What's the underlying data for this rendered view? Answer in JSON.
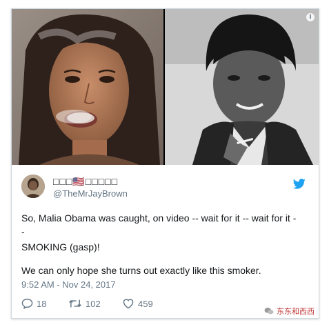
{
  "tweet": {
    "display_name": "□□□🇺🇸□□□□□",
    "handle": "@TheMrJayBrown",
    "line1": "So, Malia Obama was caught, on video -- wait for it -- wait for it -",
    "line2": "-",
    "line3": "SMOKING (gasp)!",
    "line4": "We can only hope she turns out exactly like this smoker.",
    "timestamp": "9:52 AM - Nov 24, 2017",
    "replies": "18",
    "retweets": "102",
    "likes": "459"
  },
  "watermark": {
    "text": "东东和西西"
  },
  "icons": {
    "brand": "twitter-bird-icon",
    "info": "info-icon",
    "reply": "reply-icon",
    "retweet": "retweet-icon",
    "like": "heart-icon"
  },
  "colors": {
    "twitter_blue": "#1da1f2",
    "text_primary": "#14171a",
    "text_secondary": "#657786",
    "watermark_red": "#c23b3b"
  }
}
